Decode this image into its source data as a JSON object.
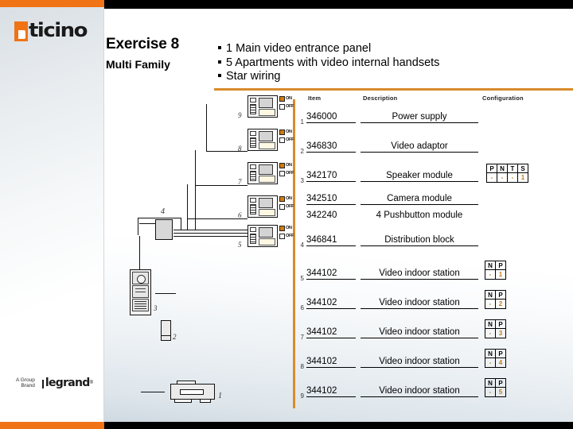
{
  "brand": {
    "logo_primary": "bticino",
    "logo_primary_first_letter": "b",
    "logo_primary_rest": "ticino",
    "footer_tagline_line1": "A Group",
    "footer_tagline_line2": "Brand",
    "footer_logo": "legrand",
    "accent_orange": "#F07316",
    "rule_orange": "#D98B2B",
    "config_value_color": "#C07A16"
  },
  "header": {
    "title": "Exercise 8",
    "subtitle": "Multi Family",
    "bullets": [
      "1 Main video entrance panel",
      "5 Apartments with video internal handsets",
      "Star wiring"
    ]
  },
  "table": {
    "columns": [
      "Item",
      "Description",
      "Configuration"
    ],
    "rows": [
      {
        "num": "1",
        "item": "346000",
        "description": "Power supply",
        "config": null
      },
      {
        "num": "2",
        "item": "346830",
        "description": "Video adaptor",
        "config": null
      },
      {
        "num": "3",
        "item": "342170",
        "description": "Speaker module",
        "config": {
          "headers": [
            "P",
            "N",
            "T",
            "S"
          ],
          "values": [
            "-",
            "-",
            "-",
            "1",
            "-",
            "-"
          ]
        }
      },
      {
        "num": "",
        "item": "342510",
        "description": "Camera module",
        "config": null
      },
      {
        "num": "",
        "item": "342240",
        "description": "4 Pushbutton module",
        "config": null
      },
      {
        "num": "4",
        "item": "346841",
        "description": "Distribution block",
        "config": null
      },
      {
        "num": "5",
        "item": "344102",
        "description": "Video indoor station",
        "config": {
          "headers": [
            "N",
            "P"
          ],
          "values": [
            "-",
            "1",
            "-"
          ]
        }
      },
      {
        "num": "6",
        "item": "344102",
        "description": "Video indoor station",
        "config": {
          "headers": [
            "N",
            "P"
          ],
          "values": [
            "-",
            "2",
            "-"
          ]
        }
      },
      {
        "num": "7",
        "item": "344102",
        "description": "Video indoor station",
        "config": {
          "headers": [
            "N",
            "P"
          ],
          "values": [
            "-",
            "3",
            "-"
          ]
        }
      },
      {
        "num": "8",
        "item": "344102",
        "description": "Video indoor station",
        "config": {
          "headers": [
            "N",
            "P"
          ],
          "values": [
            "-",
            "4",
            "-"
          ]
        }
      },
      {
        "num": "9",
        "item": "344102",
        "description": "Video indoor station",
        "config": {
          "headers": [
            "N",
            "P"
          ],
          "values": [
            "-",
            "5",
            "-"
          ]
        }
      }
    ]
  },
  "diagram": {
    "switch_labels": {
      "on": "ON",
      "off": "OFF"
    },
    "stations": [
      {
        "label": "9"
      },
      {
        "label": "8"
      },
      {
        "label": "7"
      },
      {
        "label": "6"
      },
      {
        "label": "5"
      }
    ],
    "distribution_block_label": "4",
    "entrance_panel_label": "3",
    "video_adaptor_label": "2",
    "power_supply_label": "1"
  }
}
